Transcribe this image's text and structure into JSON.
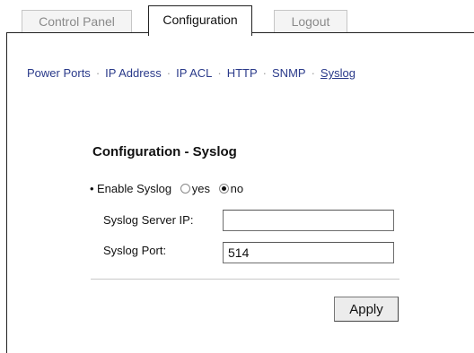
{
  "tabs": {
    "control_panel": "Control Panel",
    "configuration": "Configuration",
    "logout": "Logout"
  },
  "subnav": {
    "items": [
      "Power Ports",
      "IP Address",
      "IP ACL",
      "HTTP",
      "SNMP",
      "Syslog"
    ],
    "separator": "·",
    "active": "Syslog"
  },
  "form": {
    "title": "Configuration - Syslog",
    "enable_label": "Enable Syslog",
    "bullet": "•",
    "option_yes": "yes",
    "option_no": "no",
    "selected": "no",
    "server_ip_label": "Syslog Server IP:",
    "server_ip_value": "",
    "port_label": "Syslog Port:",
    "port_value": "514",
    "apply_label": "Apply"
  }
}
